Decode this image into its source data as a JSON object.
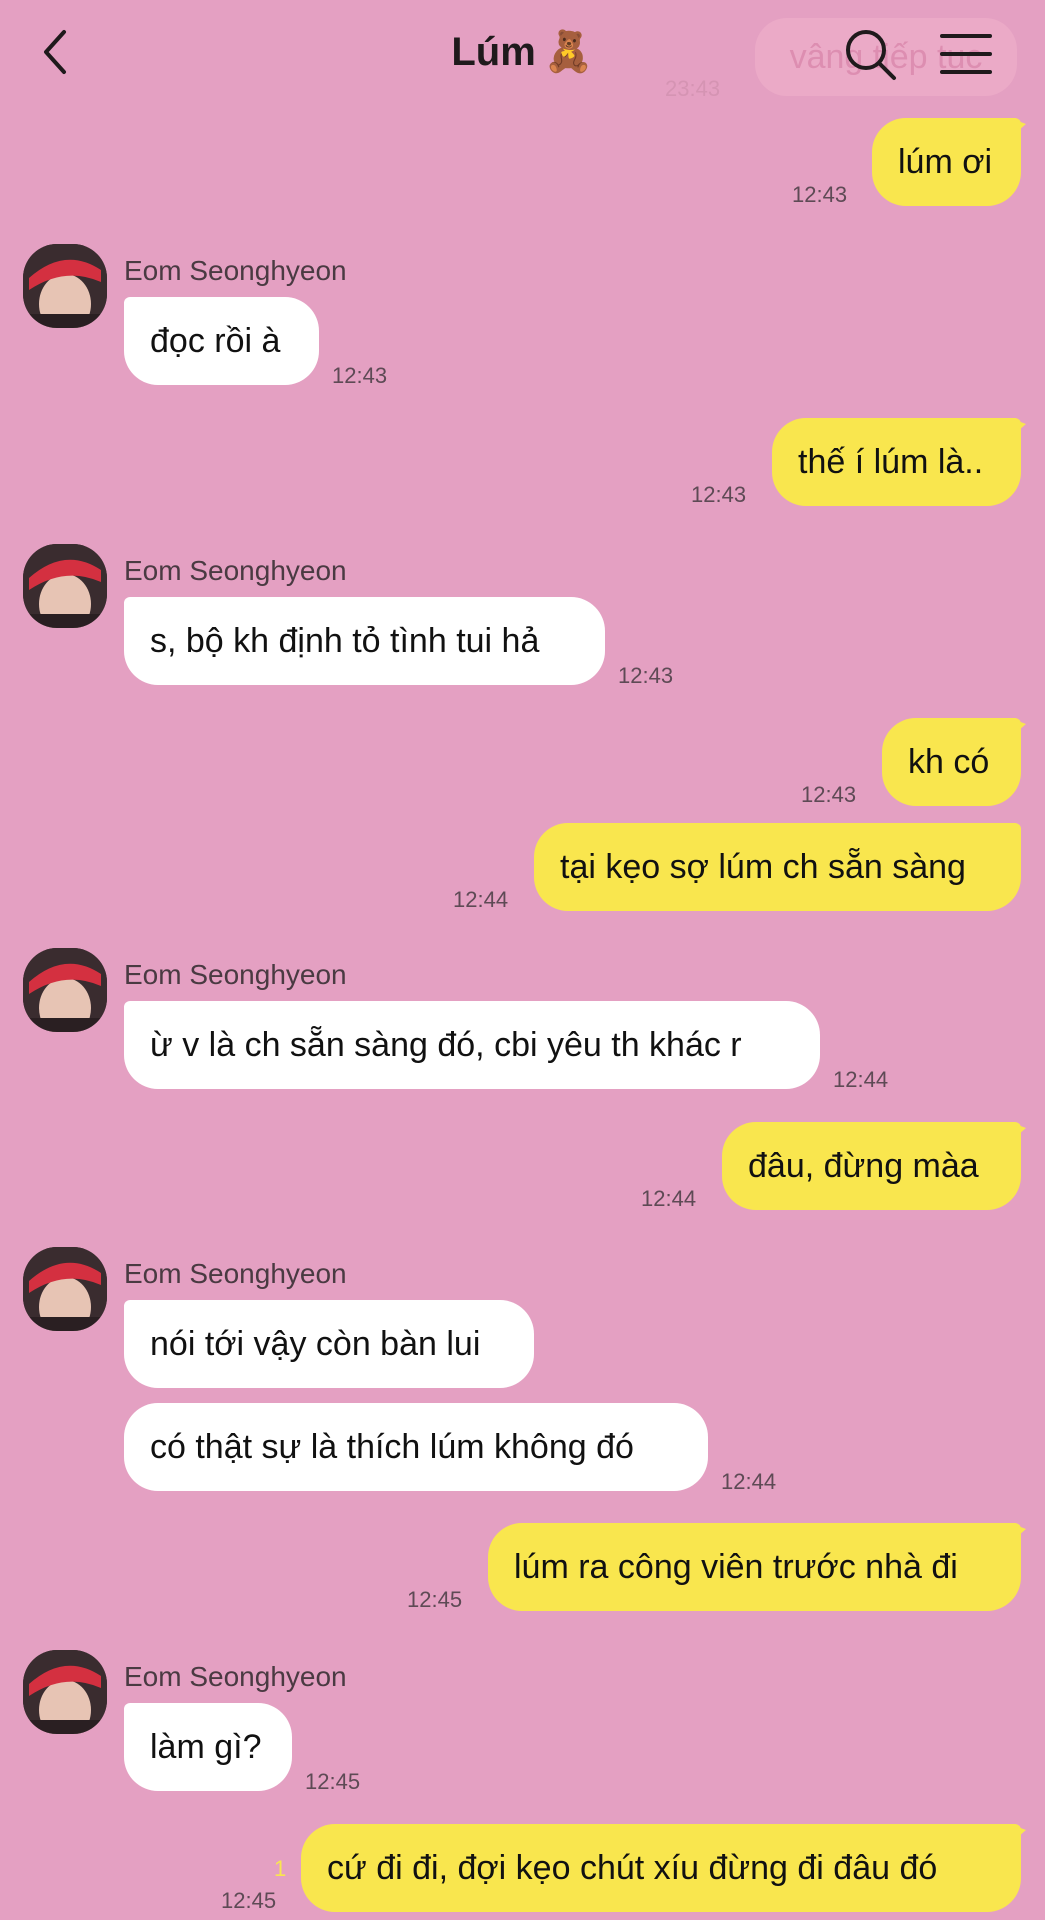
{
  "header": {
    "title": "Lúm",
    "title_emoji": "🧸",
    "ghost_text": "vâng tiếp tục",
    "ghost_time": "23:43"
  },
  "colors": {
    "background": "#e4a0c2",
    "my_bubble": "#f9e64e",
    "their_bubble": "#ffffff"
  },
  "icons": {
    "back": "chevron-left-icon",
    "search": "search-icon",
    "menu": "hamburger-menu-icon"
  },
  "messages": [
    {
      "from": "me",
      "text": "lúm ơi",
      "time": "12:43"
    },
    {
      "from": "them",
      "sender": "Eom Seonghyeon",
      "text": "đọc rồi à",
      "time": "12:43"
    },
    {
      "from": "me",
      "text": "thế í lúm là..",
      "time": "12:43"
    },
    {
      "from": "them",
      "sender": "Eom Seonghyeon",
      "text": "s, bộ kh định tỏ tình tui hả",
      "time": "12:43"
    },
    {
      "from": "me",
      "text": "kh có",
      "time": "12:43"
    },
    {
      "from": "me",
      "text": "tại kẹo sợ lúm ch sẵn sàng",
      "time": "12:44"
    },
    {
      "from": "them",
      "sender": "Eom Seonghyeon",
      "text": "ừ v là ch sẵn sàng đó, cbi yêu th khác r",
      "time": "12:44"
    },
    {
      "from": "me",
      "text": "đâu, đừng màa",
      "time": "12:44"
    },
    {
      "from": "them",
      "sender": "Eom Seonghyeon",
      "text": "nói tới vậy còn bàn lui"
    },
    {
      "from": "them",
      "text": "có thật sự là thích lúm không đó",
      "time": "12:44"
    },
    {
      "from": "me",
      "text": "lúm ra công viên trước nhà đi",
      "time": "12:45"
    },
    {
      "from": "them",
      "sender": "Eom Seonghyeon",
      "text": "làm gì?",
      "time": "12:45"
    },
    {
      "from": "me",
      "text": "cứ đi đi, đợi kẹo chút xíu đừng đi đâu đó",
      "time": "12:45",
      "unread": "1"
    }
  ]
}
